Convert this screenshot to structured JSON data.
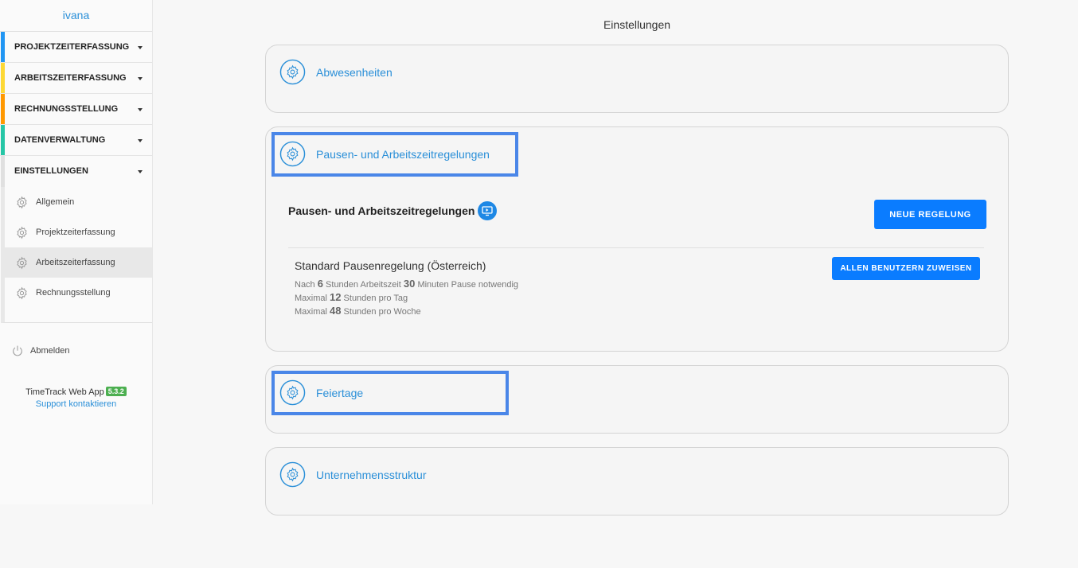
{
  "sidebar": {
    "user": "ivana",
    "nav": [
      {
        "label": "PROJEKTZEITERFASSUNG",
        "color": "#2196f3"
      },
      {
        "label": "ARBEITSZEITERFASSUNG",
        "color": "#fdd835"
      },
      {
        "label": "RECHNUNGSSTELLUNG",
        "color": "#ff9800"
      },
      {
        "label": "DATENVERWALTUNG",
        "color": "#26c6a6"
      },
      {
        "label": "EINSTELLUNGEN",
        "color": "#e0e0e0"
      }
    ],
    "sub_items": [
      "Allgemein",
      "Projektzeiterfassung",
      "Arbeitszeiterfassung",
      "Rechnungsstellung"
    ],
    "active_sub": "Arbeitszeiterfassung",
    "logout": "Abmelden",
    "app_name": "TimeTrack Web App",
    "version": "5.3.2",
    "support": "Support kontaktieren"
  },
  "main": {
    "title": "Einstellungen",
    "cards": {
      "absences": "Abwesenheiten",
      "breaks": "Pausen- und Arbeitszeitregelungen",
      "holidays": "Feiertage",
      "structure": "Unternehmensstruktur"
    },
    "breaks_section": {
      "title": "Pausen- und Arbeitszeitregelungen",
      "new_button": "NEUE REGELUNG",
      "rule": {
        "name": "Standard Pausenregelung (Österreich)",
        "assign_button": "ALLEN BENUTZERN ZUWEISEN",
        "line1": {
          "pre": "Nach",
          "hours": "6",
          "mid": "Stunden Arbeitszeit",
          "minutes": "30",
          "post": "Minuten Pause notwendig"
        },
        "line2": {
          "pre": "Maximal",
          "value": "12",
          "post": "Stunden pro Tag"
        },
        "line3": {
          "pre": "Maximal",
          "value": "48",
          "post": "Stunden pro Woche"
        }
      }
    }
  },
  "colors": {
    "accent": "#2a8fd8",
    "button": "#0a7cff",
    "highlight": "#4a86e8"
  }
}
